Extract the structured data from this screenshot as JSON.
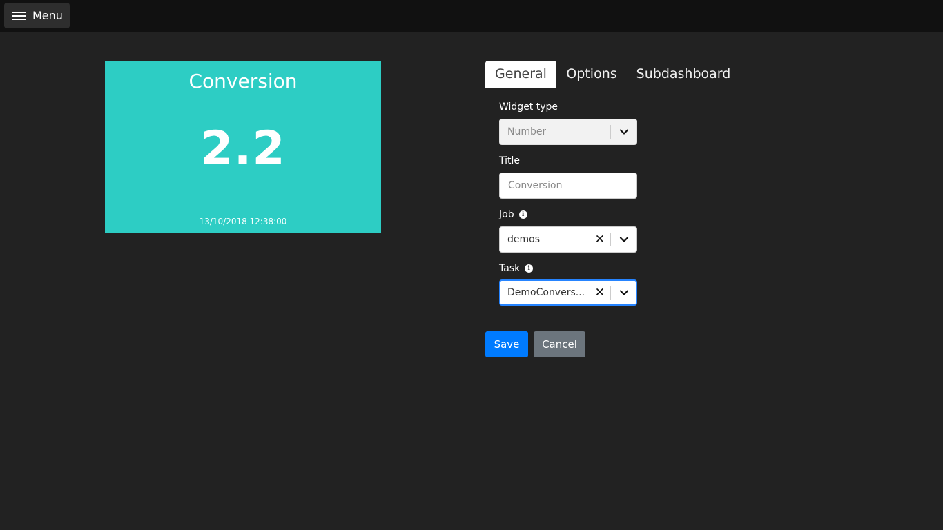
{
  "header": {
    "menu_label": "Menu"
  },
  "widget": {
    "title": "Conversion",
    "value": "2.2",
    "timestamp": "13/10/2018 12:38:00",
    "background_color": "#2dcdc4"
  },
  "tabs": [
    {
      "label": "General",
      "active": true
    },
    {
      "label": "Options",
      "active": false
    },
    {
      "label": "Subdashboard",
      "active": false
    }
  ],
  "form": {
    "widget_type": {
      "label": "Widget type",
      "value": "Number"
    },
    "title": {
      "label": "Title",
      "placeholder": "Conversion",
      "value": ""
    },
    "job": {
      "label": "Job",
      "value": "demos"
    },
    "task": {
      "label": "Task",
      "value": "DemoConvers..."
    }
  },
  "buttons": {
    "save": "Save",
    "cancel": "Cancel",
    "save_color": "#007bff",
    "cancel_color": "#6c757d"
  },
  "icons": [
    "menu-icon",
    "info-icon",
    "clear-icon",
    "chevron-down-icon"
  ]
}
